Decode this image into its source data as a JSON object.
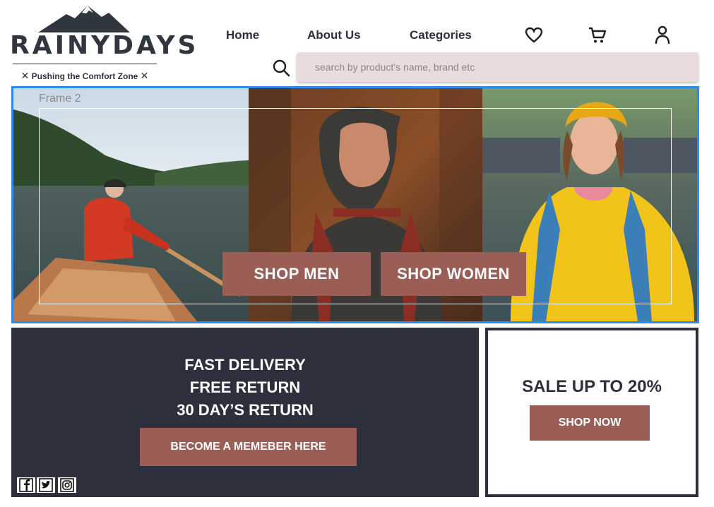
{
  "brand": {
    "name": "RAINYDAYS",
    "tagline": "Pushing the Comfort Zone",
    "tagline_mark": "✕"
  },
  "nav": {
    "items": [
      {
        "label": "Home"
      },
      {
        "label": "About Us"
      },
      {
        "label": "Categories"
      }
    ],
    "icons": [
      "heart-icon",
      "cart-icon",
      "user-icon"
    ]
  },
  "search": {
    "placeholder": "search by product’s name, brand etc",
    "icon": "search-icon"
  },
  "hero": {
    "frame_label": "Frame 2",
    "shop_men_label": "SHOP MEN",
    "shop_women_label": "SHOP WOMEN"
  },
  "promo": {
    "line1": "FAST DELIVERY",
    "line2": "FREE RETURN",
    "line3": "30 DAY’S RETURN",
    "member_label": "BECOME A MEMEBER HERE",
    "social_icons": [
      "facebook-icon",
      "twitter-icon",
      "instagram-icon"
    ]
  },
  "sale": {
    "title": "SALE UP TO 20%",
    "button_label": "SHOP NOW"
  },
  "colors": {
    "accent": "#9a5e56",
    "dark": "#2d303c",
    "search_bg": "#eadcdc",
    "frame_border": "#2d8ceb"
  }
}
